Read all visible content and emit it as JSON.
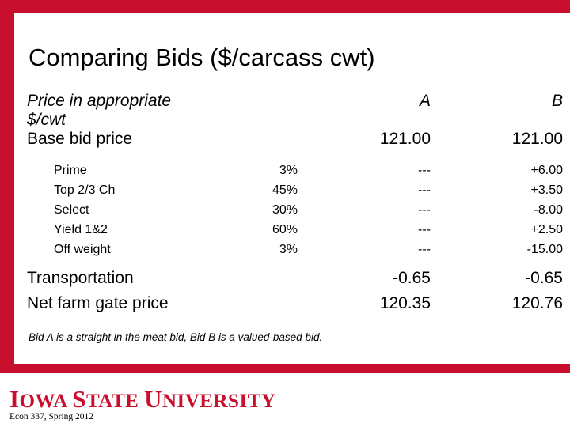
{
  "slide": {
    "title": "Comparing Bids ($/carcass cwt)",
    "footnote": "Bid A is a straight in the meat bid, Bid B is a valued-based bid.",
    "accent_color": "#C8102E"
  },
  "table": {
    "header": {
      "label": "Price in appropriate $/cwt",
      "percent": "",
      "bid_a": "A",
      "bid_b": "B"
    },
    "base": {
      "label": "Base bid price",
      "percent": "",
      "bid_a": "121.00",
      "bid_b": "121.00"
    },
    "items": [
      {
        "label": "Prime",
        "percent": "3%",
        "bid_a": "---",
        "bid_b": "+6.00"
      },
      {
        "label": "Top 2/3 Ch",
        "percent": "45%",
        "bid_a": "---",
        "bid_b": "+3.50"
      },
      {
        "label": "Select",
        "percent": "30%",
        "bid_a": "---",
        "bid_b": "-8.00"
      },
      {
        "label": "Yield 1&2",
        "percent": "60%",
        "bid_a": "---",
        "bid_b": "+2.50"
      },
      {
        "label": "Off weight",
        "percent": "3%",
        "bid_a": "---",
        "bid_b": "-15.00"
      }
    ],
    "totals": [
      {
        "label": "Transportation",
        "percent": "",
        "bid_a": "-0.65",
        "bid_b": "-0.65"
      },
      {
        "label": "Net farm gate price",
        "percent": "",
        "bid_a": "120.35",
        "bid_b": "120.76"
      }
    ]
  },
  "footer": {
    "logo_parts": {
      "i": "I",
      "owa": "OWA",
      "s": "S",
      "tate": "TATE",
      "u": "U",
      "niversity": "NIVERSITY"
    },
    "logo_text": "IOWA STATE UNIVERSITY",
    "course": "Econ 337, Spring 2012"
  }
}
